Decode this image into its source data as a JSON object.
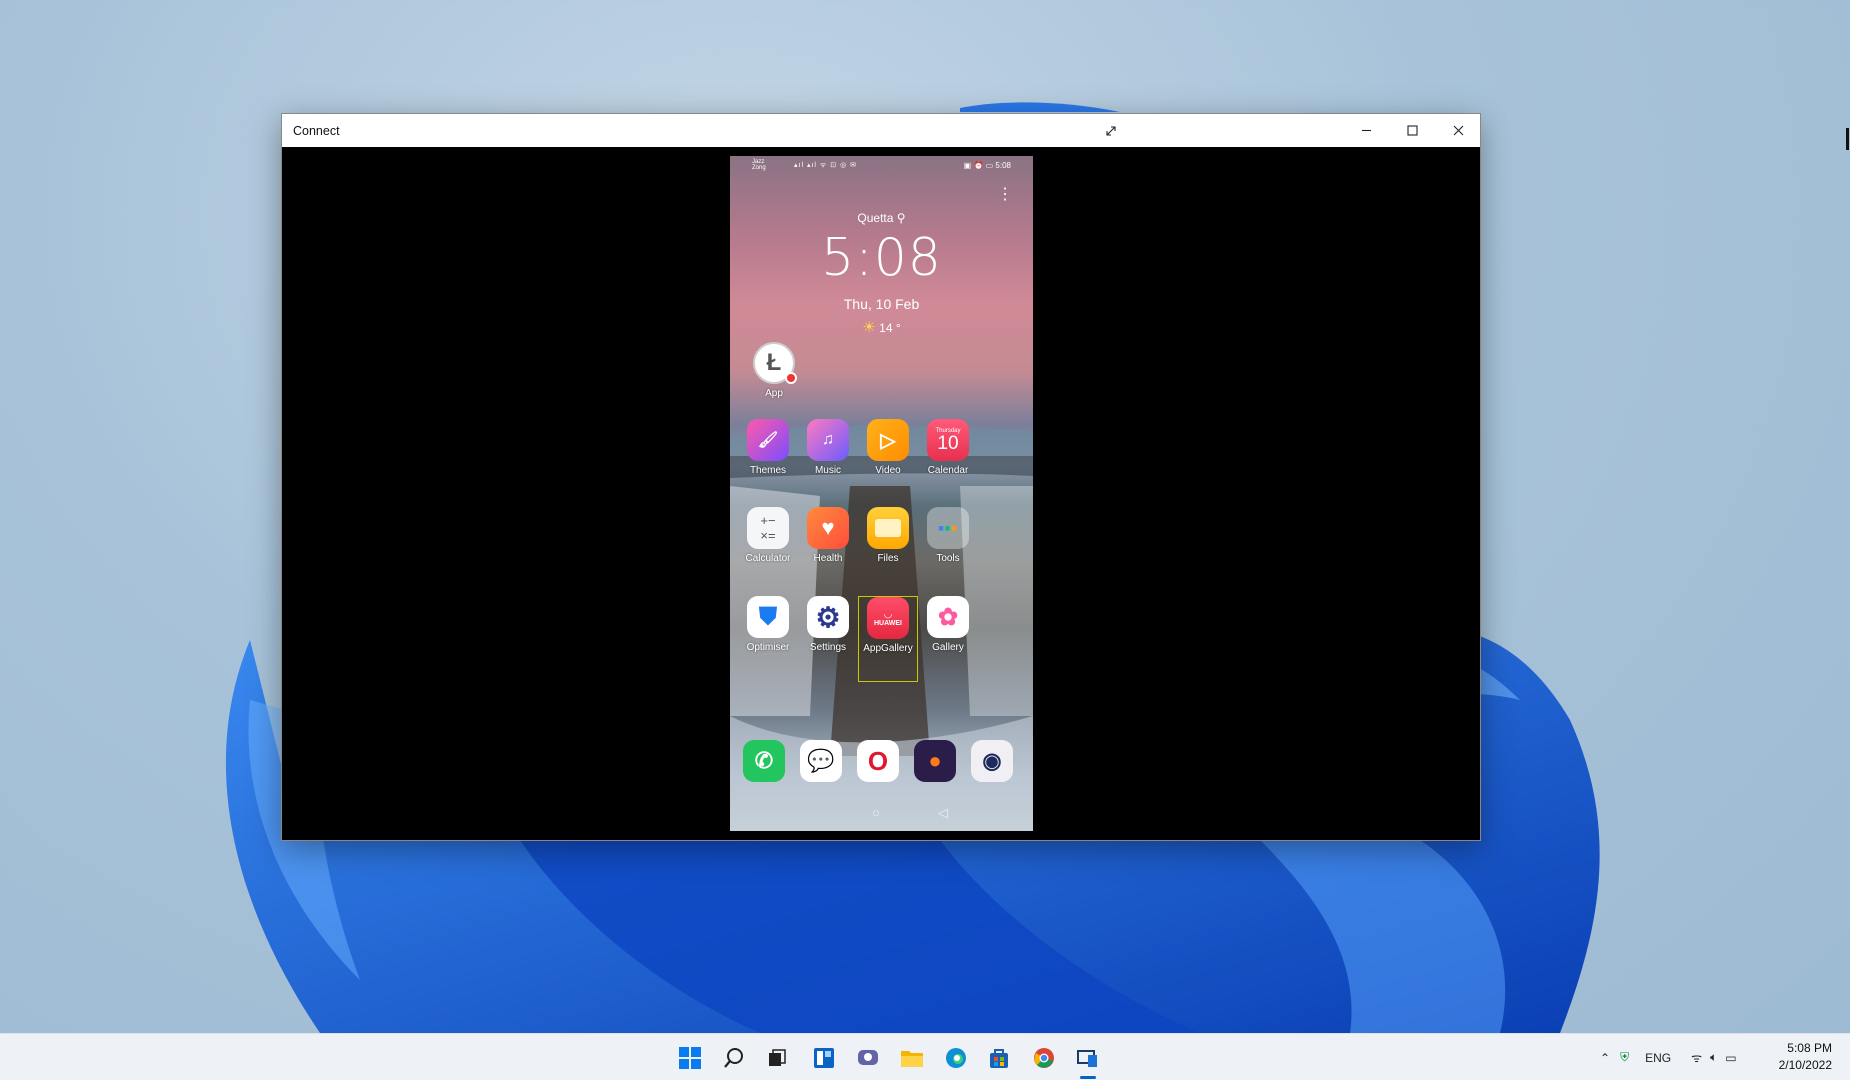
{
  "window": {
    "title": "Connect",
    "controls": [
      "expand-icon",
      "minimize-icon",
      "maximize-icon",
      "close-icon"
    ]
  },
  "phone": {
    "status": {
      "carrier_line1": "Jazz",
      "carrier_line2": "Zong",
      "indicators": "▴ıl ▴ıl ᯤ ⊡ ◎ ✉",
      "right": "▣ ⏰ ▭ 5:08"
    },
    "lockscreen": {
      "location": "Quetta",
      "time": "5:08",
      "date": "Thu, 10 Feb",
      "temperature": "14 °"
    },
    "apps": {
      "app": "App",
      "themes": "Themes",
      "music": "Music",
      "video": "Video",
      "calendar": "Calendar",
      "calendar_day": "Thursday",
      "calendar_date": "10",
      "calculator": "Calculator",
      "health": "Health",
      "files": "Files",
      "tools": "Tools",
      "optimiser": "Optimiser",
      "settings": "Settings",
      "appgallery": "AppGallery",
      "appgallery_brand": "HUAWEI",
      "gallery": "Gallery"
    },
    "dock": [
      "phone-icon",
      "messages-icon",
      "opera-icon",
      "firefox-icon",
      "camera-icon"
    ]
  },
  "taskbar": {
    "apps": [
      "start-icon",
      "search-icon",
      "task-view-icon",
      "widgets-icon",
      "chat-icon",
      "file-explorer-icon",
      "edge-icon",
      "store-icon",
      "chrome-icon",
      "connect-icon"
    ],
    "language": "ENG",
    "time": "5:08 PM",
    "date": "2/10/2022"
  },
  "colors": {
    "accent": "#0067c0",
    "bloom_blue": "#1565e0"
  }
}
